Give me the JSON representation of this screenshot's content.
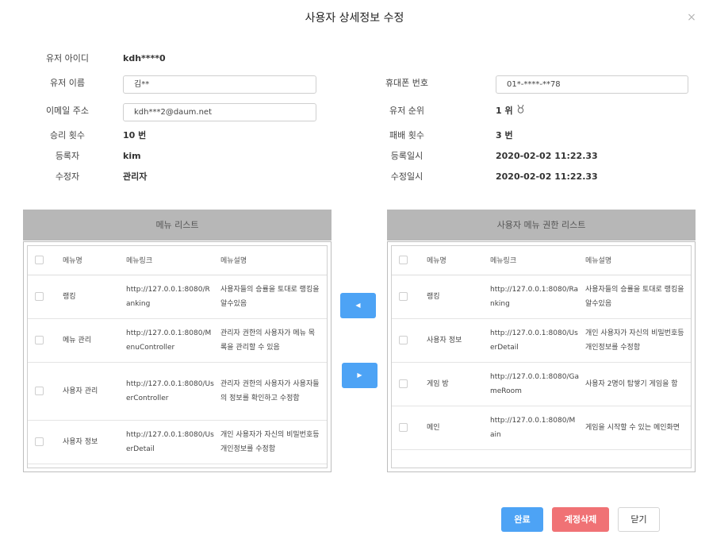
{
  "modal": {
    "title": "사용자 상세정보 수정",
    "close_icon": "×"
  },
  "info": {
    "user_id": {
      "label": "유저 아이디",
      "value": "kdh****0"
    },
    "user_name": {
      "label": "유저 이름",
      "value": "김**"
    },
    "phone": {
      "label": "휴대폰 번호",
      "value": "01*-****-**78"
    },
    "email": {
      "label": "이메일 주소",
      "value": "kdh***2@daum.net"
    },
    "rank": {
      "label": "유저 순위",
      "value": "1 위",
      "icon": "medal-icon"
    },
    "wins": {
      "label": "승리 횟수",
      "value": "10 번"
    },
    "losses": {
      "label": "패배 횟수",
      "value": "3 번"
    },
    "created_by": {
      "label": "등록자",
      "value": "kim"
    },
    "created_at": {
      "label": "등록일시",
      "value": "2020-02-02 11:22.33"
    },
    "modified_by": {
      "label": "수정자",
      "value": "관리자"
    },
    "modified_at": {
      "label": "수정일시",
      "value": "2020-02-02 11:22.33"
    }
  },
  "menu_list": {
    "title": "메뉴 리스트",
    "columns": {
      "name": "메뉴명",
      "link": "메뉴링크",
      "desc": "메뉴설명"
    },
    "rows": [
      {
        "name": "랭킹",
        "link": "http://127.0.0.1:8080/Ranking",
        "desc": "사용자들의 승률을 토대로 랭킹을 알수있음"
      },
      {
        "name": "메뉴 관리",
        "link": "http://127.0.0.1:8080/MenuController",
        "desc": "관리자 권한의 사용자가 메뉴 목록을 관리할 수 있음"
      },
      {
        "name": "사용자 관리",
        "link": "http://127.0.0.1:8080/UserController",
        "desc": "관리자 권한의 사용자가 사용자들의 정보를 확인하고 수정함"
      },
      {
        "name": "사용자 정보",
        "link": "http://127.0.0.1:8080/UserDetail",
        "desc": "개인 사용자가 자신의 비밀번호등 개인정보를 수정함"
      }
    ]
  },
  "user_menu_list": {
    "title": "사용자 메뉴 권한 리스트",
    "columns": {
      "name": "메뉴명",
      "link": "메뉴링크",
      "desc": "메뉴설명"
    },
    "rows": [
      {
        "name": "랭킹",
        "link": "http://127.0.0.1:8080/Ranking",
        "desc": "사용자들의 승률을 토대로 랭킹을 알수있음"
      },
      {
        "name": "사용자 정보",
        "link": "http://127.0.0.1:8080/UserDetail",
        "desc": "개인 사용자가 자신의 비밀번호등 개인정보를 수정함"
      },
      {
        "name": "게임 방",
        "link": "http://127.0.0.1:8080/GameRoom",
        "desc": "사용자 2명이 탑쌓기 게임을 함"
      },
      {
        "name": "메인",
        "link": "http://127.0.0.1:8080/Main",
        "desc": "게임을 시작할 수 있는 메인화면"
      }
    ]
  },
  "transfer": {
    "left_icon": "◀",
    "right_icon": "▶"
  },
  "buttons": {
    "confirm": "완료",
    "delete": "계정삭제",
    "close": "닫기"
  },
  "colors": {
    "primary": "#4da3f5",
    "danger": "#f07275",
    "panel_header": "#b7b7b7"
  }
}
